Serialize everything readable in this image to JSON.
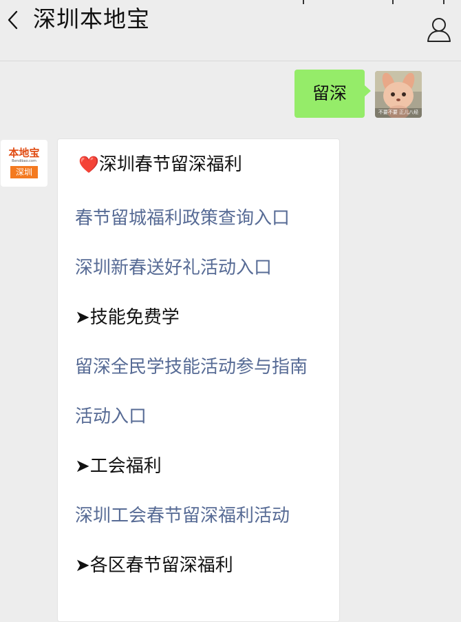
{
  "header": {
    "title": "深圳本地宝",
    "back_icon": "chevron-left-icon",
    "user_icon": "person-icon"
  },
  "chat": {
    "outgoing": {
      "text": "留深",
      "avatar_caption": "不要不要 正儿八经"
    },
    "bot": {
      "logo_text": "本地宝",
      "logo_url": "Bendibao.com",
      "logo_city": "深圳"
    },
    "card": {
      "heading_emoji": "❤️",
      "heading": "深圳春节留深福利",
      "lines": [
        {
          "text": "春节留城福利政策查询入口",
          "type": "link"
        },
        {
          "text": "深圳新春送好礼活动入口",
          "type": "link"
        },
        {
          "text": "➤技能免费学",
          "type": "text"
        },
        {
          "text": "留深全民学技能活动参与指南",
          "type": "link"
        },
        {
          "text": "活动入口",
          "type": "link"
        },
        {
          "text": "➤工会福利",
          "type": "text"
        },
        {
          "text": "深圳工会春节留深福利活动",
          "type": "link"
        },
        {
          "text": "➤各区春节留深福利",
          "type": "text"
        }
      ]
    }
  },
  "colors": {
    "background": "#ededed",
    "bubble_green": "#95ec69",
    "link": "#576b95",
    "logo_orange": "#f47a20"
  }
}
